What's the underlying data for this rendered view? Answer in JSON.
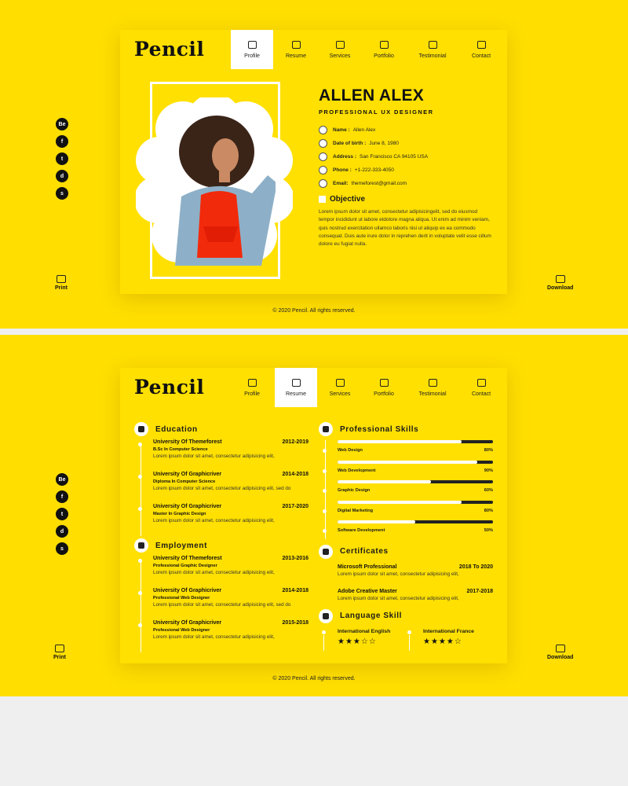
{
  "brand": "Pencil",
  "nav": [
    {
      "label": "Profile"
    },
    {
      "label": "Resume"
    },
    {
      "label": "Services"
    },
    {
      "label": "Portfolio"
    },
    {
      "label": "Testimonial"
    },
    {
      "label": "Contact"
    }
  ],
  "social": [
    "Be",
    "f",
    "t",
    "d",
    "s"
  ],
  "print_label": "Print",
  "download_label": "Download",
  "footer": "© 2020 Pencil. All rights reserved.",
  "profile": {
    "name": "ALLEN ALEX",
    "role": "PROFESSIONAL UX DESIGNER",
    "info": [
      {
        "label": "Name :",
        "value": "Allen Alex"
      },
      {
        "label": "Date of birth :",
        "value": "June 8, 1980"
      },
      {
        "label": "Address :",
        "value": "San Francisco CA 94105 USA"
      },
      {
        "label": "Phone :",
        "value": "+1-222-333-4050"
      },
      {
        "label": "Email:",
        "value": "themeforest@gmail.com"
      }
    ],
    "objective_title": "Objective",
    "objective_text": "Lorem ipsum dolor sit amet, consectetur adipisicingelit, sed do eiusmod tempor incididunt ut labore etdolore magna aliqua. Ut enim ad minim veniam, quis nostrud exercitation ullamco laboris nisi ut aliquip ex ea commodo consequat. Duis aute irure dolor in reprehen derit in voluptate velit esse cillum dolore eu fugiat nulla."
  },
  "resume": {
    "education_title": "Education",
    "education": [
      {
        "school": "University Of Themeforest",
        "years": "2012-2019",
        "degree": "B.Sc In Computer Science",
        "desc": "Lorem ipsum dolor sit amet, consectetur adipisicing elit,"
      },
      {
        "school": "University Of Graphicriver",
        "years": "2014-2018",
        "degree": "Diploma In Computer Science",
        "desc": "Lorem ipsum dolor sit amet, consectetur adipisicing elit, sed do"
      },
      {
        "school": "University Of Graphicriver",
        "years": "2017-2020",
        "degree": "Master In Graphic Design",
        "desc": "Lorem ipsum dolor sit amet, consectetur adipisicing elit,"
      }
    ],
    "employment_title": "Employment",
    "employment": [
      {
        "school": "University Of Themeforest",
        "years": "2013-2016",
        "degree": "Professional Graphic Designer",
        "desc": "Lorem ipsum dolor sit amet, consectetur adipisicing elit,"
      },
      {
        "school": "University Of Graphicriver",
        "years": "2014-2018",
        "degree": "Professional Web Designer",
        "desc": "Lorem ipsum dolor sit amet, consectetur adipisicing elit, sed do"
      },
      {
        "school": "University Of Graphicriver",
        "years": "2015-2018",
        "degree": "Professional Web Designer",
        "desc": "Lorem ipsum dolor sit amet, consectetur adipisicing elit,"
      }
    ],
    "skills_title": "Professional Skills",
    "skills": [
      {
        "name": "Web Design",
        "percent": "80%",
        "level": 0.8
      },
      {
        "name": "Web Development",
        "percent": "90%",
        "level": 0.9
      },
      {
        "name": "Graphic Design",
        "percent": "60%",
        "level": 0.6
      },
      {
        "name": "Digital Marketing",
        "percent": "80%",
        "level": 0.8
      },
      {
        "name": "Software Development",
        "percent": "50%",
        "level": 0.5
      }
    ],
    "certificates_title": "Certificates",
    "certificates": [
      {
        "name": "Microsoft Professional",
        "years": "2018 To 2020",
        "desc": "Lorem ipsum dolor sit amet, consectetur adipisicing elit,"
      },
      {
        "name": "Adobe Creative Master",
        "years": "2017-2018",
        "desc": "Lorem ipsum dolor sit amet, consectetur adipisicing elit,"
      }
    ],
    "language_title": "Language Skill",
    "languages": [
      {
        "name": "International English",
        "stars": "★★★☆☆",
        "rating": 3
      },
      {
        "name": "International France",
        "stars": "★★★★☆",
        "rating": 4
      }
    ]
  }
}
